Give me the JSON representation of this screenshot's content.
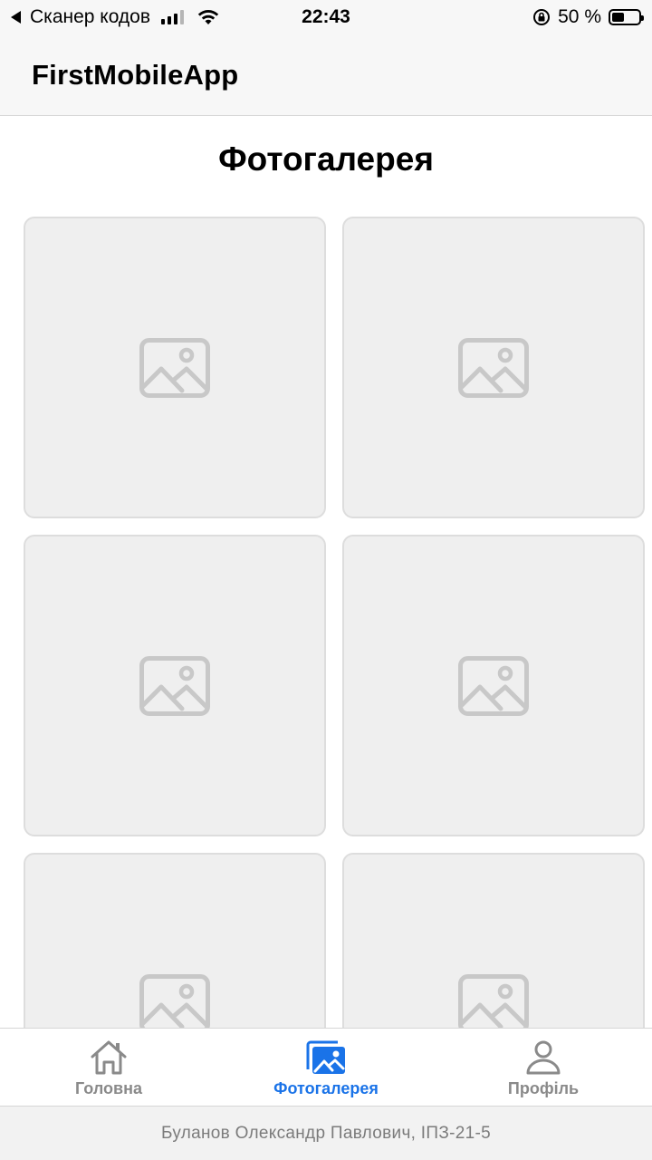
{
  "status_bar": {
    "back_app": "Сканер кодов",
    "time": "22:43",
    "battery_percent": "50 %"
  },
  "header": {
    "title": "FirstMobileApp"
  },
  "page": {
    "heading": "Фотогалерея"
  },
  "gallery": {
    "tile_count": 6,
    "placeholder_icon": "image-placeholder-icon"
  },
  "tab_bar": {
    "items": [
      {
        "label": "Головна",
        "icon": "home-icon",
        "active": false
      },
      {
        "label": "Фотогалерея",
        "icon": "gallery-icon",
        "active": true
      },
      {
        "label": "Профіль",
        "icon": "profile-icon",
        "active": false
      }
    ],
    "active_color": "#1a73e8",
    "inactive_color": "#8a8a8a"
  },
  "footer": {
    "text": "Буланов Олександр Павлович, ІПЗ-21-5"
  }
}
